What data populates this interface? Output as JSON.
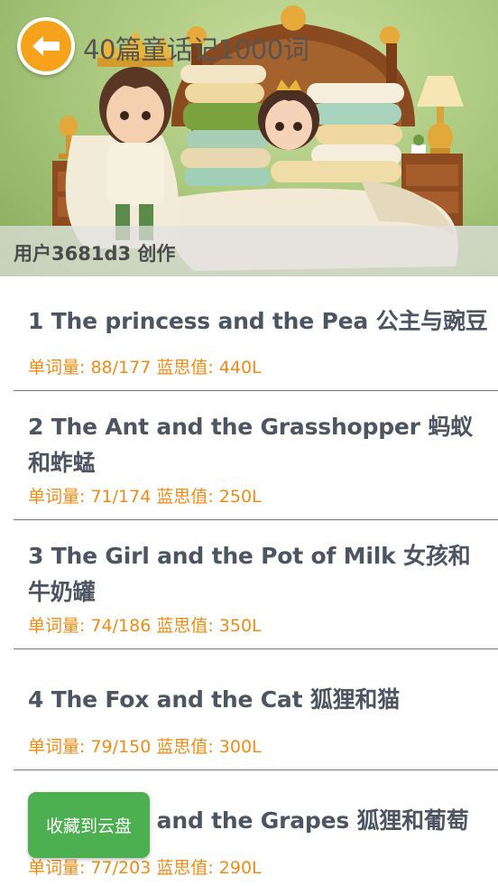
{
  "header": {
    "title": "40篇童话记1000词",
    "author": "用户3681d3 创作",
    "back_icon": "arrow-left-icon"
  },
  "stories": [
    {
      "title": "1 The princess and the Pea 公主与豌豆",
      "meta": "单词量: 88/177 蓝思值: 440L"
    },
    {
      "title": "2 The Ant and the Grasshopper 蚂蚁和蚱蜢",
      "meta": "单词量: 71/174 蓝思值: 250L"
    },
    {
      "title": "3 The Girl and the Pot of Milk 女孩和牛奶罐",
      "meta": "单词量: 74/186 蓝思值: 350L"
    },
    {
      "title": "4 The Fox and the Cat 狐狸和猫",
      "meta": "单词量: 79/150 蓝思值: 300L"
    },
    {
      "title": "5 The Fox and the Grapes 狐狸和葡萄",
      "meta": "单词量: 77/203 蓝思值: 290L"
    }
  ],
  "actions": {
    "save_to_cloud": "收藏到云盘"
  },
  "colors": {
    "accent": "#f7a21b",
    "meta_text": "#f08c16",
    "title_text": "#4d5462",
    "button_green": "#4caf50"
  }
}
